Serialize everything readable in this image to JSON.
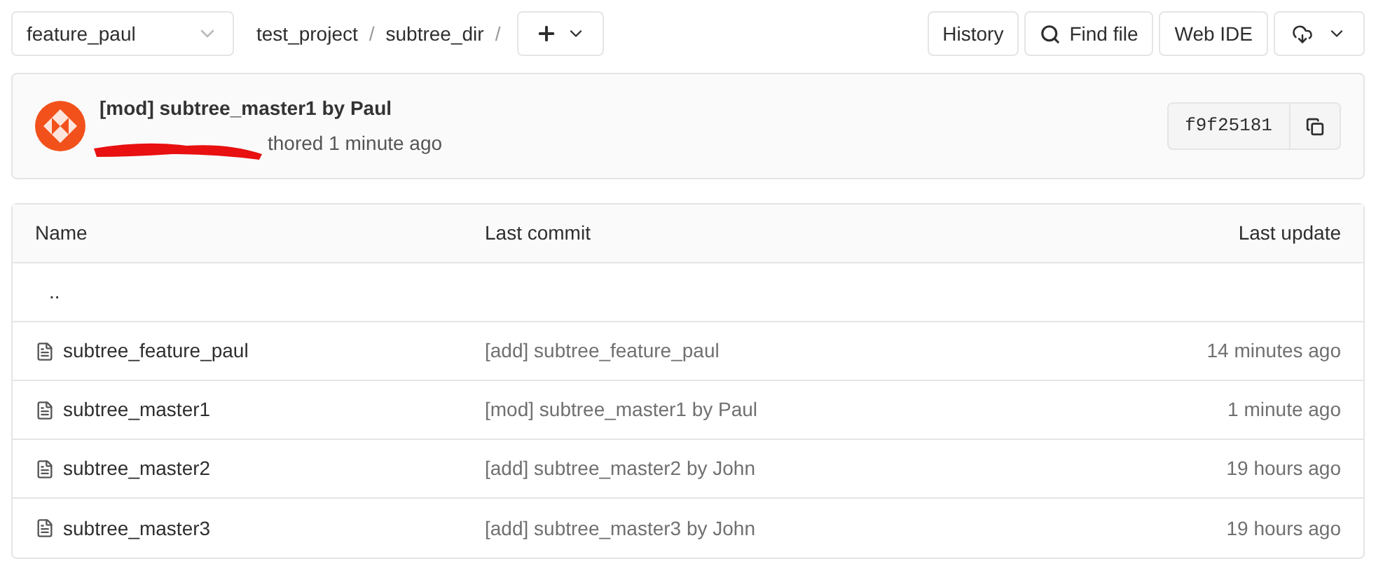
{
  "branch": {
    "value": "feature_paul"
  },
  "breadcrumb": [
    {
      "label": "test_project",
      "separator": "/"
    },
    {
      "label": "subtree_dir",
      "separator": "/"
    }
  ],
  "actions": [
    {
      "kind": "text",
      "label": "History"
    },
    {
      "kind": "search",
      "label": "Find file"
    },
    {
      "kind": "text",
      "label": "Web IDE"
    },
    {
      "kind": "download"
    }
  ],
  "commit": {
    "title": "[mod] subtree_master1 by Paul",
    "author_line": "thored 1 minute ago",
    "redacted": true,
    "sha": "f9f25181"
  },
  "table": {
    "columns": [
      "Name",
      "Last commit",
      "Last update"
    ],
    "rows": [
      {
        "kind": "parent",
        "name": ".."
      },
      {
        "kind": "file",
        "name": "subtree_feature_paul",
        "commit": "[add] subtree_feature_paul",
        "updated": "14 minutes ago"
      },
      {
        "kind": "file",
        "name": "subtree_master1",
        "commit": "[mod] subtree_master1 by Paul",
        "updated": "1 minute ago"
      },
      {
        "kind": "file",
        "name": "subtree_master2",
        "commit": "[add] subtree_master2 by John",
        "updated": "19 hours ago"
      },
      {
        "kind": "file",
        "name": "subtree_master3",
        "commit": "[add] subtree_master3 by John",
        "updated": "19 hours ago"
      }
    ]
  }
}
